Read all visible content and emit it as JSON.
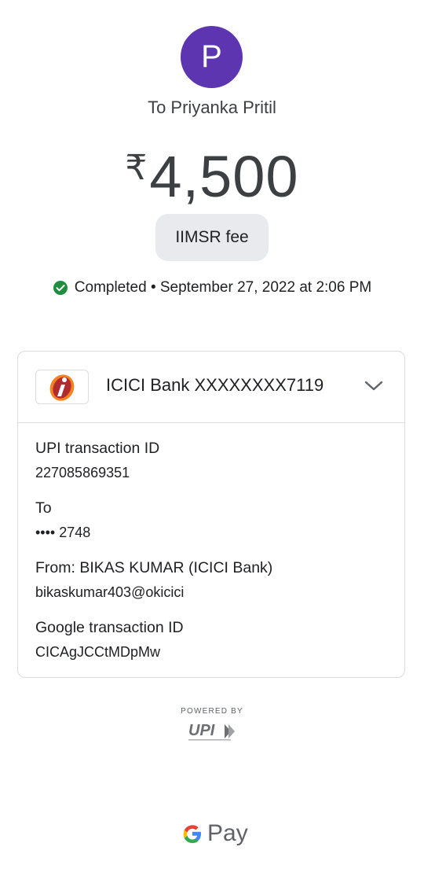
{
  "payee": {
    "initial": "P",
    "title": "To Priyanka Pritil",
    "currency_symbol": "₹",
    "amount": "4,500",
    "note": "IIMSR fee"
  },
  "status": {
    "text": "Completed • September 27, 2022 at 2:06 PM",
    "color": "#1e8e3e"
  },
  "bank": {
    "name": "ICICI Bank XXXXXXXX7119"
  },
  "details": [
    {
      "label": "UPI transaction ID",
      "value": "227085869351"
    },
    {
      "label": "To",
      "value": "•••• 2748"
    },
    {
      "label": "From: BIKAS KUMAR (ICICI Bank)",
      "value": "bikaskumar403@okicici"
    },
    {
      "label": "Google transaction ID",
      "value": "CICAgJCCtMDpMw"
    }
  ],
  "footer": {
    "powered_by": "POWERED BY",
    "upi_logo": "UPI",
    "brand_pay": "Pay"
  },
  "colors": {
    "avatar": "#5e35b1",
    "note_bg": "#e8eaed",
    "border": "#dadce0"
  }
}
